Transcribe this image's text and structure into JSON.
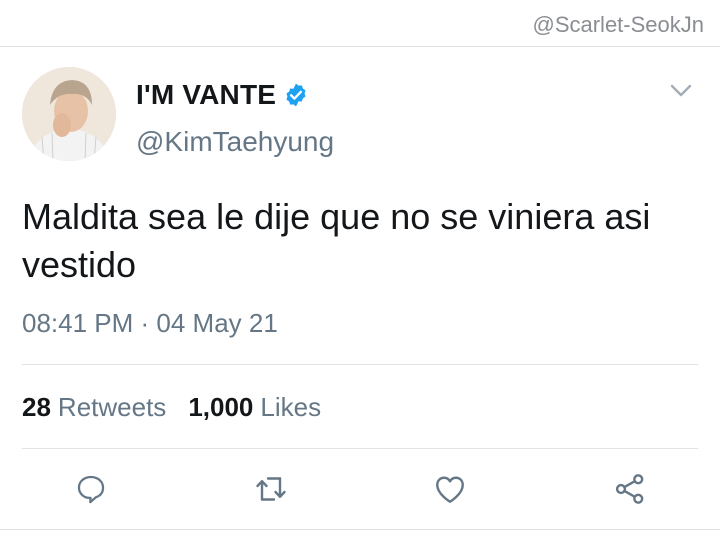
{
  "watermark": "@Scarlet-SeokJn",
  "tweet": {
    "display_name": "I'M VANTE",
    "handle": "@KimTaehyung",
    "verified": true,
    "text": "Maldita sea le dije que no se viniera asi vestido",
    "timestamp": "08:41 PM · 04 May 21"
  },
  "stats": {
    "retweets_count": "28",
    "retweets_label": "Retweets",
    "likes_count": "1,000",
    "likes_label": "Likes"
  },
  "actions": [
    "reply-icon",
    "retweet-icon",
    "like-icon",
    "share-icon"
  ],
  "colors": {
    "verified_blue": "#1da1f2",
    "icon_gray": "#657786",
    "divider": "#e1e4e6"
  }
}
